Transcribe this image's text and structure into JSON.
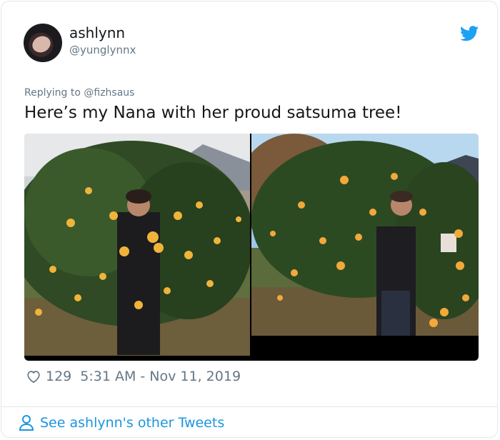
{
  "user": {
    "name": "ashlynn",
    "handle": "@yunglynnx"
  },
  "tweet": {
    "replying_to": "Replying to @fizhsaus",
    "text": "Here’s my Nana with her proud satsuma tree!",
    "likes": "129",
    "timestamp": "5:31 AM - Nov 11, 2019"
  },
  "footer": {
    "link_label": "See ashlynn's other Tweets"
  },
  "colors": {
    "accent": "#1da1f2",
    "link": "#1b95e0",
    "secondary_text": "#657786"
  },
  "icons": [
    "twitter-bird-icon",
    "heart-icon",
    "person-icon"
  ]
}
